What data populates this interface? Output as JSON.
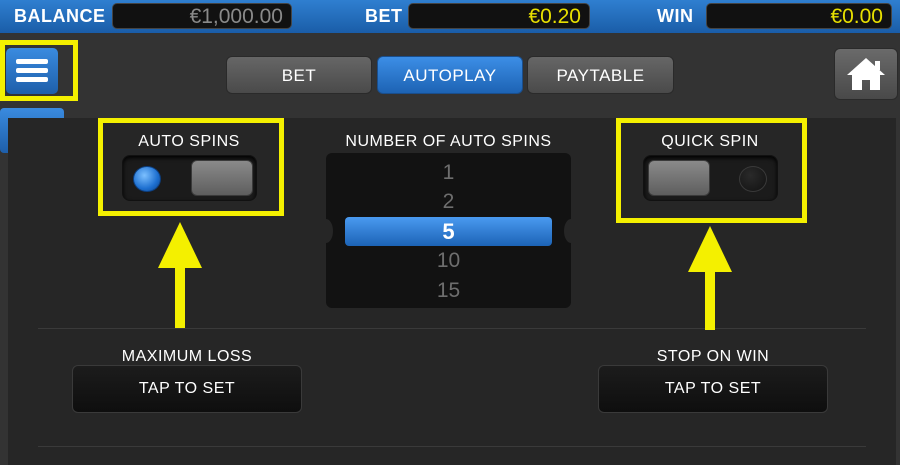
{
  "header": {
    "balance_label": "BALANCE",
    "balance_value": "€1,000.00",
    "bet_label": "BET",
    "bet_value": "€0.20",
    "win_label": "WIN",
    "win_value": "€0.00"
  },
  "tabs": [
    {
      "label": "BET",
      "active": false
    },
    {
      "label": "AUTOPLAY",
      "active": true
    },
    {
      "label": "PAYTABLE",
      "active": false
    }
  ],
  "nav": {
    "menu_icon": "hamburger-icon",
    "back_icon": "arrow-left-icon",
    "home_icon": "home-icon"
  },
  "auto_spins": {
    "label": "AUTO SPINS",
    "on": true
  },
  "number_of_auto_spins": {
    "label": "NUMBER OF AUTO SPINS",
    "options": [
      "1",
      "2",
      "5",
      "10",
      "15"
    ],
    "selected": "5"
  },
  "quick_spin": {
    "label": "QUICK SPIN",
    "on": false
  },
  "maximum_loss": {
    "label": "MAXIMUM LOSS",
    "button": "TAP TO SET"
  },
  "stop_on_win": {
    "label": "STOP ON WIN",
    "button": "TAP TO SET"
  },
  "colors": {
    "accent_blue": "#1d63b4",
    "value_yellow": "#e8e000",
    "value_grey": "#8a8a8a",
    "annotation_yellow": "#f4f000"
  }
}
